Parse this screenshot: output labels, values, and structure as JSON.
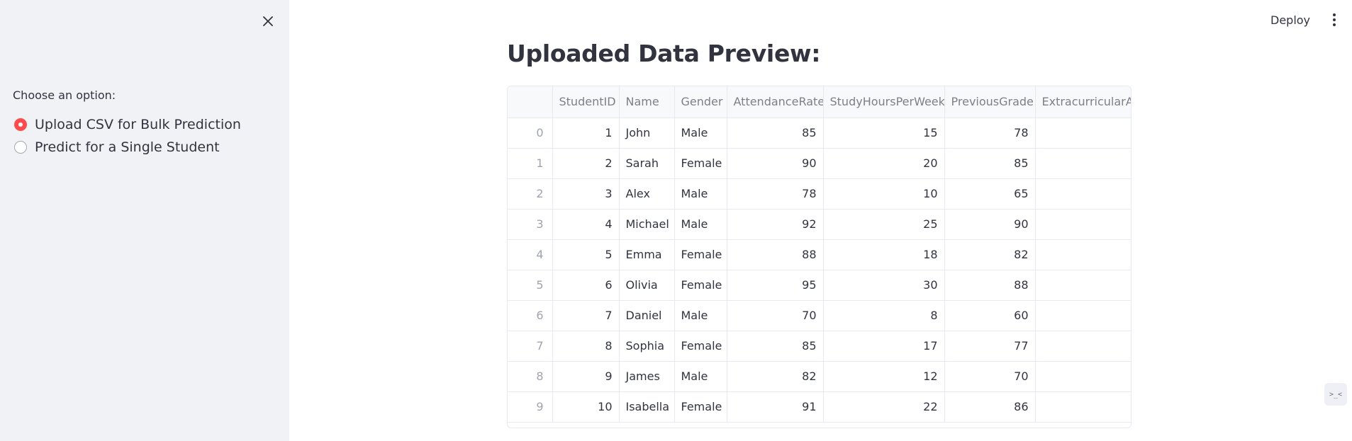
{
  "sidebar": {
    "radio_label": "Choose an option:",
    "options": [
      {
        "label": "Upload CSV for Bulk Prediction",
        "selected": true
      },
      {
        "label": "Predict for a Single Student",
        "selected": false
      }
    ]
  },
  "header": {
    "deploy_label": "Deploy"
  },
  "main": {
    "title": "Uploaded Data Preview:",
    "table": {
      "columns": [
        "StudentID",
        "Name",
        "Gender",
        "AttendanceRate",
        "StudyHoursPerWeek",
        "PreviousGrade",
        "ExtracurricularAc"
      ],
      "rows": [
        {
          "index": "0",
          "cells": [
            "1",
            "John",
            "Male",
            "85",
            "15",
            "78",
            ""
          ]
        },
        {
          "index": "1",
          "cells": [
            "2",
            "Sarah",
            "Female",
            "90",
            "20",
            "85",
            ""
          ]
        },
        {
          "index": "2",
          "cells": [
            "3",
            "Alex",
            "Male",
            "78",
            "10",
            "65",
            ""
          ]
        },
        {
          "index": "3",
          "cells": [
            "4",
            "Michael",
            "Male",
            "92",
            "25",
            "90",
            ""
          ]
        },
        {
          "index": "4",
          "cells": [
            "5",
            "Emma",
            "Female",
            "88",
            "18",
            "82",
            ""
          ]
        },
        {
          "index": "5",
          "cells": [
            "6",
            "Olivia",
            "Female",
            "95",
            "30",
            "88",
            ""
          ]
        },
        {
          "index": "6",
          "cells": [
            "7",
            "Daniel",
            "Male",
            "70",
            "8",
            "60",
            ""
          ]
        },
        {
          "index": "7",
          "cells": [
            "8",
            "Sophia",
            "Female",
            "85",
            "17",
            "77",
            ""
          ]
        },
        {
          "index": "8",
          "cells": [
            "9",
            "James",
            "Male",
            "82",
            "12",
            "70",
            ""
          ]
        },
        {
          "index": "9",
          "cells": [
            "10",
            "Isabella",
            "Female",
            "91",
            "22",
            "86",
            ""
          ]
        }
      ]
    }
  },
  "status_widget": {
    "glyph": ">_<"
  },
  "colors": {
    "accent": "#ff4b4b",
    "sidebar_bg": "#f0f2f6",
    "text": "#31333f",
    "header_text": "#7c7f89",
    "border": "#e6e9ef"
  }
}
